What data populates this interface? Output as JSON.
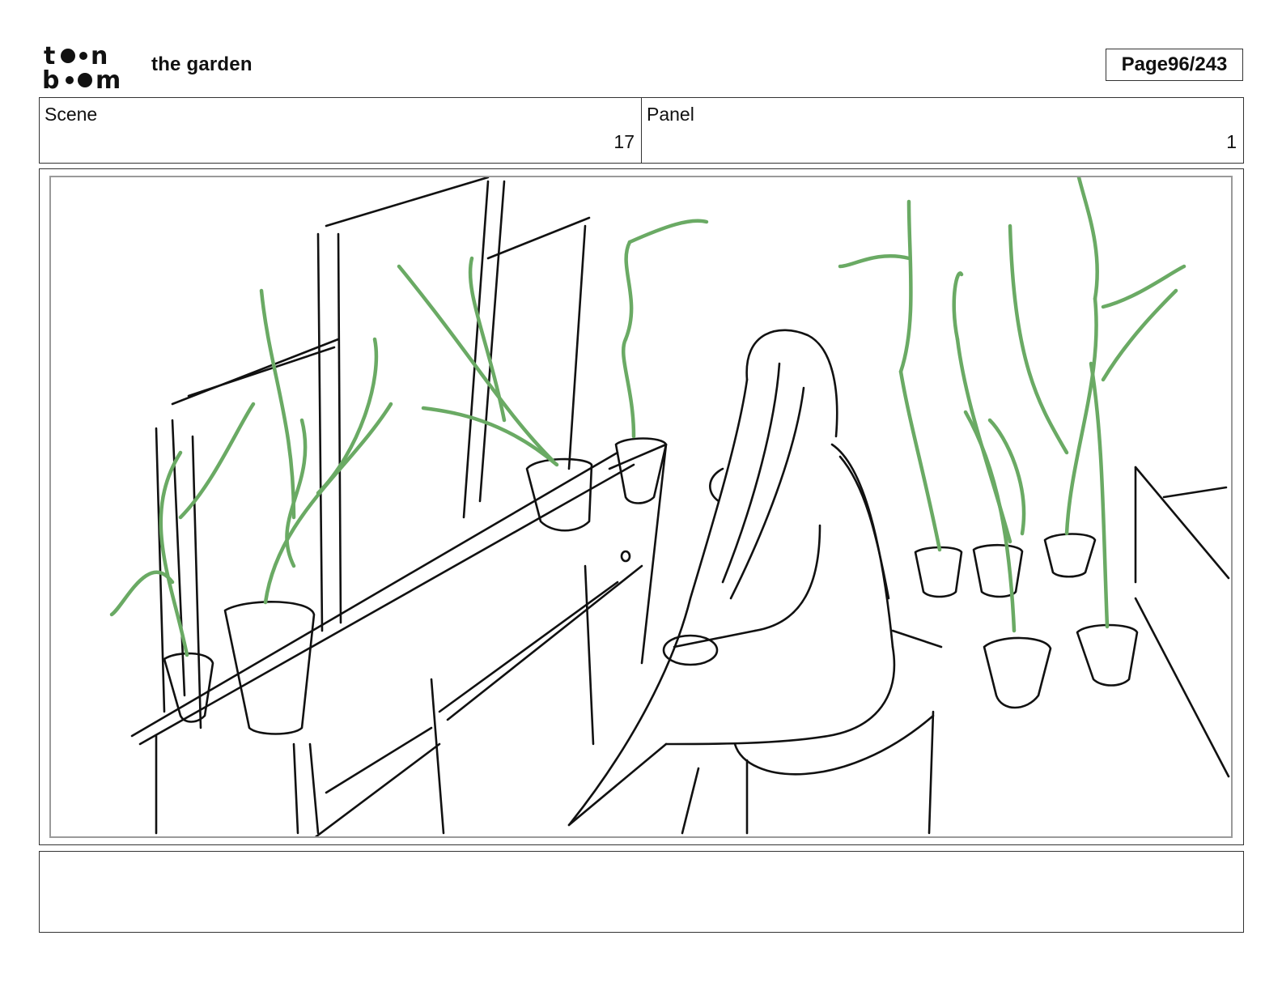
{
  "header": {
    "logo_text": "toon boom",
    "logo_icon": "toon-boom-logo",
    "project_title": "the garden",
    "page_label": "Page",
    "page_number": "96/243"
  },
  "info": {
    "scene_label": "Scene",
    "scene_value": "17",
    "panel_label": "Panel",
    "panel_value": "1"
  },
  "panel": {
    "sketch_subject": "storyboard sketch",
    "line_color": "#111111",
    "plant_color": "#6aaa64"
  },
  "caption": {
    "text": ""
  }
}
